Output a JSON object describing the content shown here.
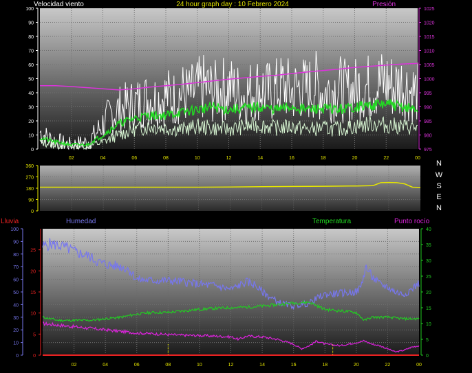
{
  "header": {
    "left_title": "Velocidad viento",
    "center_title": "24 hour graph day : 10 Febrero 2024",
    "right_title": "Presión"
  },
  "bottom_header": {
    "rain": "Lluvia",
    "humidity": "Humedad",
    "temperature": "Temperatura",
    "dewpoint": "Punto rocío"
  },
  "colors": {
    "wind": "#ffffff",
    "gust": "#d7f5d2",
    "wind_avg": "#22dd22",
    "pressure": "#dd33dd",
    "direction": "#e6e600",
    "humidity": "#7777ee",
    "temperature": "#22cc22",
    "dewpoint": "#dd22dd",
    "rain": "#ee2222",
    "axis_title_yellow": "#e6e600"
  },
  "chart_data": [
    {
      "type": "line",
      "panel": "wind-pressure",
      "x_ticks": [
        "02",
        "04",
        "06",
        "08",
        "10",
        "12",
        "14",
        "16",
        "18",
        "20",
        "22",
        "00"
      ],
      "x_range_hours": [
        0,
        24
      ],
      "y_left": {
        "ticks": [
          "0",
          "10",
          "20",
          "30",
          "40",
          "50",
          "60",
          "70",
          "80",
          "90",
          "100"
        ],
        "range": [
          0,
          100
        ]
      },
      "y_right": {
        "ticks": [
          "975",
          "980",
          "985",
          "990",
          "995",
          "1000",
          "1005",
          "1010",
          "1015",
          "1020",
          "1025"
        ],
        "range": [
          975,
          1025
        ]
      },
      "grid": true,
      "series": [
        {
          "name": "Presión",
          "axis": "right",
          "x": [
            0,
            1,
            2,
            3,
            4,
            5,
            6,
            7,
            8,
            9,
            10,
            11,
            12,
            13,
            14,
            15,
            16,
            17,
            18,
            19,
            20,
            21,
            22,
            23,
            24
          ],
          "y": [
            997.5,
            997.5,
            997.2,
            996.8,
            996.4,
            996.0,
            996.4,
            997.0,
            997.5,
            998.0,
            998.6,
            999.2,
            999.8,
            1000.3,
            1000.8,
            1001.2,
            1001.8,
            1002.4,
            1002.9,
            1003.4,
            1004.0,
            1004.4,
            1004.8,
            1005.2,
            1005.4
          ]
        },
        {
          "name": "",
          "axis": "left",
          "role": "wind",
          "x": [
            0,
            0.5,
            1,
            1.5,
            2,
            2.5,
            3,
            3.5,
            4,
            4.5,
            5,
            5.5,
            6,
            6.5,
            7,
            7.5,
            8,
            8.5,
            9,
            9.5,
            10,
            10.5,
            11,
            11.5,
            12,
            12.5,
            13,
            13.5,
            14,
            14.5,
            15,
            15.5,
            16,
            16.5,
            17,
            17.5,
            18,
            18.5,
            19,
            19.5,
            20,
            20.5,
            21,
            21.5,
            22,
            22.5,
            23,
            23.5,
            24
          ],
          "y": [
            12,
            8,
            6,
            4,
            3,
            4,
            5,
            10,
            18,
            24,
            28,
            30,
            32,
            34,
            36,
            35,
            38,
            36,
            40,
            38,
            42,
            44,
            40,
            42,
            44,
            40,
            38,
            42,
            44,
            40,
            42,
            45,
            40,
            44,
            42,
            46,
            40,
            42,
            44,
            40,
            42,
            45,
            44,
            46,
            48,
            44,
            46,
            42,
            40
          ]
        },
        {
          "name": "",
          "axis": "left",
          "role": "gust",
          "x": [
            0,
            1,
            2,
            3,
            4,
            5,
            6,
            7,
            8,
            9,
            10,
            11,
            12,
            13,
            14,
            15,
            16,
            17,
            18,
            19,
            20,
            21,
            22,
            23,
            24
          ],
          "y": [
            5,
            3,
            2,
            2,
            5,
            10,
            14,
            16,
            15,
            14,
            16,
            15,
            14,
            16,
            17,
            15,
            16,
            14,
            15,
            14,
            16,
            18,
            17,
            16,
            15
          ]
        },
        {
          "name": "",
          "axis": "left",
          "role": "wind-average",
          "x": [
            0,
            1,
            2,
            3,
            4,
            5,
            6,
            7,
            8,
            9,
            10,
            11,
            12,
            13,
            14,
            15,
            16,
            17,
            18,
            19,
            20,
            21,
            22,
            23,
            24
          ],
          "y": [
            8,
            5,
            3,
            3,
            10,
            18,
            22,
            24,
            24,
            26,
            28,
            30,
            28,
            29,
            30,
            28,
            30,
            28,
            29,
            28,
            30,
            31,
            32,
            30,
            28
          ]
        }
      ]
    },
    {
      "type": "line",
      "panel": "wind-direction",
      "x_range_hours": [
        0,
        24
      ],
      "y_left": {
        "ticks": [
          "0",
          "90",
          "180",
          "270",
          "360"
        ],
        "range": [
          0,
          360
        ]
      },
      "y_right_labels": [
        "N",
        "W",
        "S",
        "E",
        "N"
      ],
      "grid": true,
      "series": [
        {
          "name": "",
          "role": "direction",
          "x": [
            0,
            2,
            4,
            6,
            8,
            10,
            12,
            14,
            16,
            18,
            20,
            21,
            21.5,
            22,
            22.5,
            23,
            23.5,
            24
          ],
          "y": [
            188,
            188,
            188,
            188,
            188,
            188,
            190,
            192,
            194,
            196,
            198,
            200,
            224,
            226,
            224,
            215,
            188,
            186
          ]
        }
      ]
    },
    {
      "type": "line",
      "panel": "humidity-temperature",
      "x_ticks": [
        "02",
        "04",
        "06",
        "08",
        "10",
        "12",
        "14",
        "16",
        "18",
        "20",
        "22",
        "00"
      ],
      "x_range_hours": [
        0,
        24
      ],
      "y_left_humidity": {
        "ticks": [
          "0",
          "10",
          "20",
          "30",
          "40",
          "50",
          "60",
          "70",
          "80",
          "90",
          "100"
        ],
        "range": [
          0,
          100
        ]
      },
      "y_left_rain": {
        "ticks": [
          "0",
          "5",
          "10",
          "15",
          "20",
          "25"
        ],
        "range": [
          0,
          30
        ]
      },
      "y_right": {
        "ticks": [
          "0",
          "5",
          "10",
          "15",
          "20",
          "25",
          "30",
          "35",
          "40"
        ],
        "range": [
          0,
          40
        ]
      },
      "grid": true,
      "series": [
        {
          "name": "Humedad",
          "axis": "left_humidity",
          "x": [
            0,
            0.5,
            1,
            1.5,
            2,
            2.5,
            3,
            3.5,
            4,
            4.5,
            5,
            5.5,
            6,
            7,
            8,
            9,
            10,
            11,
            12,
            12.5,
            13,
            13.5,
            14,
            14.5,
            15,
            15.5,
            16,
            16.5,
            17,
            17.5,
            18,
            19,
            20,
            20.3,
            20.6,
            21,
            21.5,
            22,
            22.5,
            23,
            23.5,
            24
          ],
          "y": [
            86,
            88,
            87,
            85,
            82,
            80,
            78,
            74,
            72,
            71,
            70,
            68,
            60,
            59,
            59,
            58,
            56,
            55,
            52,
            55,
            58,
            56,
            50,
            46,
            42,
            40,
            39,
            40,
            41,
            45,
            48,
            49,
            50,
            54,
            70,
            62,
            56,
            54,
            50,
            48,
            52,
            57
          ]
        },
        {
          "name": "Temperatura",
          "axis": "right",
          "x": [
            0,
            1,
            2,
            3,
            4,
            5,
            6,
            7,
            8,
            9,
            10,
            11,
            12,
            13,
            14,
            15,
            16,
            17,
            18,
            19,
            20,
            20.5,
            21,
            22,
            23,
            24
          ],
          "y": [
            12,
            11,
            11,
            11,
            11.5,
            12,
            13,
            13.5,
            13.5,
            14,
            14.5,
            14.8,
            15,
            15.2,
            15.5,
            16,
            16.5,
            16.8,
            14.5,
            14,
            13.5,
            11,
            12,
            12,
            11.5,
            11.5
          ]
        },
        {
          "name": "Punto rocío",
          "axis": "right",
          "x": [
            0,
            1,
            2,
            3,
            4,
            5,
            6,
            7,
            8,
            9,
            10,
            11,
            12,
            12.5,
            13,
            14,
            15,
            16,
            16.5,
            17,
            17.5,
            18,
            19,
            20,
            20.5,
            21,
            21.5,
            22,
            22.5,
            23,
            23.5,
            24
          ],
          "y": [
            10,
            9.5,
            9,
            8.5,
            8,
            7.5,
            7,
            6.8,
            6.5,
            6.3,
            6.2,
            6,
            5.8,
            5,
            6,
            5.8,
            5,
            3.5,
            2,
            3,
            4.5,
            3.5,
            3,
            4,
            4.5,
            3.5,
            3,
            2,
            1,
            1.5,
            2.5,
            3
          ]
        },
        {
          "name": "Lluvia",
          "axis": "left_rain",
          "x": [
            0,
            24
          ],
          "y": [
            0,
            0
          ]
        }
      ]
    }
  ]
}
